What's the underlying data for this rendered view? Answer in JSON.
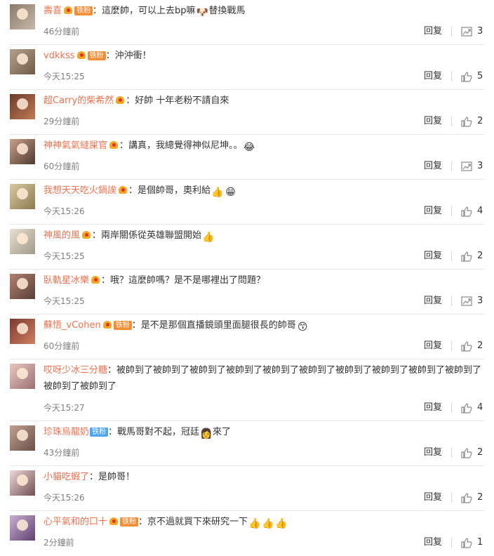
{
  "actions": {
    "reply_label": "回复"
  },
  "icons": {
    "like": "thumbs-up-icon",
    "forward": "share-icon"
  },
  "colors": {
    "username": "#eb7350",
    "meta": "#808080",
    "fan_badge": "#f78d37",
    "fan_badge_alt": "#4ea6f5"
  },
  "comments": [
    {
      "user": "壽喜",
      "vip": true,
      "fan_badge": "铁粉",
      "sep": "：",
      "parts": [
        "這麼帥，可以上去bp嘛",
        "替換戰馬"
      ],
      "emoji": [
        "🐶"
      ],
      "time": "46分鐘前",
      "icon": "share",
      "count": "3"
    },
    {
      "user": "vdkkss",
      "vip": true,
      "fan_badge": "铁粉",
      "sep": "：",
      "parts": [
        "沖沖衝！"
      ],
      "emoji": [],
      "time": "今天15:25",
      "icon": "like",
      "count": "5"
    },
    {
      "user": "超Carry的柴希然",
      "vip": true,
      "fan_badge": "",
      "sep": "：",
      "parts": [
        "好帥 十年老粉不請自來"
      ],
      "emoji": [],
      "time": "29分鐘前",
      "icon": "like",
      "count": "2"
    },
    {
      "user": "神神氣氣縫屎官",
      "vip": true,
      "fan_badge": "",
      "sep": "：",
      "parts": [
        "講真，我總覺得神似尼坤。。"
      ],
      "emoji": [
        "😂"
      ],
      "time": "60分鐘前",
      "icon": "share",
      "count": "3"
    },
    {
      "user": "我想天天吃火鍋誒",
      "vip": true,
      "fan_badge": "",
      "sep": "：",
      "parts": [
        "是個帥哥，奧利給"
      ],
      "emoji": [
        "👍",
        "😁"
      ],
      "time": "今天15:26",
      "icon": "like",
      "count": "4"
    },
    {
      "user": "神風的風",
      "vip": true,
      "fan_badge": "",
      "sep": "：",
      "parts": [
        "兩岸關係從英雄聯盟開始"
      ],
      "emoji": [
        "👍"
      ],
      "time": "今天15:25",
      "icon": "like",
      "count": "2"
    },
    {
      "user": "臥軌星冰樂",
      "vip": true,
      "fan_badge": "",
      "sep": "：",
      "parts": [
        "哦？這麼帥嗎？是不是哪裡出了問題？"
      ],
      "emoji": [],
      "time": "今天15:25",
      "icon": "share",
      "count": "3"
    },
    {
      "user": "蘇悟_vCohen",
      "vip": true,
      "fan_badge": "铁粉",
      "sep": "：",
      "parts": [
        "是不是那個直播鏡頭里面腿很長的帥哥"
      ],
      "emoji": [
        "😙"
      ],
      "time": "60分鐘前",
      "icon": "like",
      "count": "2"
    },
    {
      "user": "哎呀少冰三分糖",
      "vip": false,
      "fan_badge": "",
      "sep": "：",
      "parts": [
        "被帥到了被帥到了被帥到了被帥到了被帥到了被帥到了被帥到了被帥到了被帥到了被帥到了被帥到了被帥到了"
      ],
      "emoji": [],
      "time": "今天15:27",
      "icon": "like",
      "count": "4"
    },
    {
      "user": "珍珠烏龍奶",
      "vip": false,
      "fan_badge": "铁粉",
      "fan_alt": true,
      "sep": "：",
      "parts": [
        "戰馬哥對不起，冠廷",
        "來了"
      ],
      "emoji": [
        "👩"
      ],
      "time": "43分鐘前",
      "icon": "like",
      "count": "2"
    },
    {
      "user": "小貓吃蝦了",
      "vip": false,
      "fan_badge": "",
      "sep": "：",
      "parts": [
        "是帥哥！"
      ],
      "emoji": [],
      "time": "今天15:26",
      "icon": "like",
      "count": "2"
    },
    {
      "user": "心平氣和的口十",
      "vip": true,
      "fan_badge": "铁粉",
      "sep": "：",
      "parts": [
        "京不過就買下來研究一下"
      ],
      "emoji": [
        "👍",
        "👍",
        "👍"
      ],
      "time": "2分鐘前",
      "icon": "like",
      "count": "1"
    }
  ]
}
